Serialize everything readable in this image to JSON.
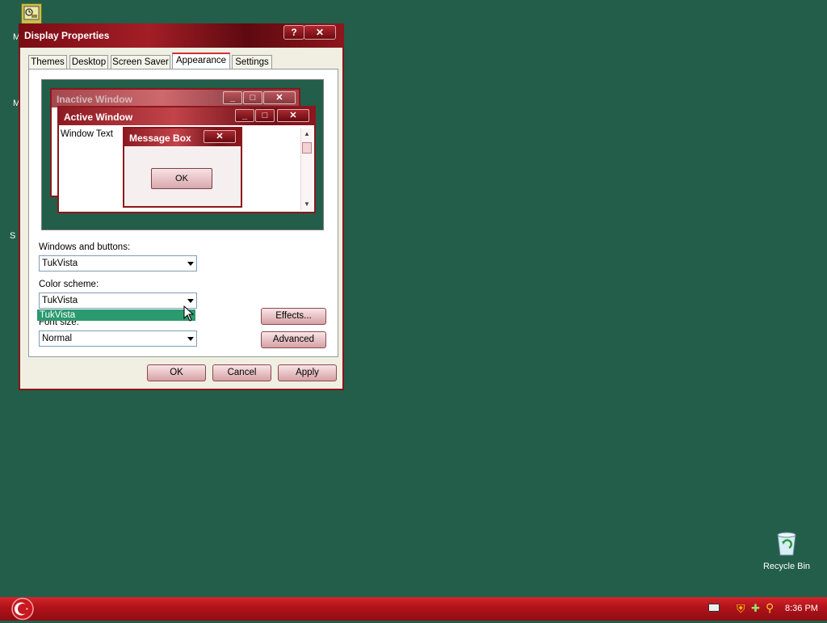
{
  "desktop": {
    "recycle_bin_label": "Recycle Bin",
    "partial_label_1": "M",
    "partial_label_2": "M",
    "partial_label_3": "S"
  },
  "dialog": {
    "title": "Display Properties",
    "help_button": "?",
    "close_button": "✕",
    "tabs": [
      {
        "label": "Themes"
      },
      {
        "label": "Desktop"
      },
      {
        "label": "Screen Saver"
      },
      {
        "label": "Appearance",
        "active": true
      },
      {
        "label": "Settings"
      }
    ],
    "preview": {
      "inactive_title": "Inactive Window",
      "active_title": "Active Window",
      "window_text": "Window Text",
      "message_box_title": "Message Box",
      "message_box_ok": "OK",
      "close_glyph": "✕"
    },
    "windows_buttons_label": "Windows and buttons:",
    "windows_buttons_value": "TukVista",
    "color_scheme_label": "Color scheme:",
    "color_scheme_value": "TukVista",
    "color_scheme_dropdown_option": "TukVista",
    "font_size_label": "Font size:",
    "font_size_value": "Normal",
    "effects_button": "Effects...",
    "advanced_button": "Advanced",
    "ok_button": "OK",
    "cancel_button": "Cancel",
    "apply_button": "Apply"
  },
  "taskbar": {
    "clock": "8:36 PM"
  },
  "colors": {
    "desktop": "#225e4a",
    "title_red": "#8d161c",
    "selection_green": "#2b9a6e"
  }
}
